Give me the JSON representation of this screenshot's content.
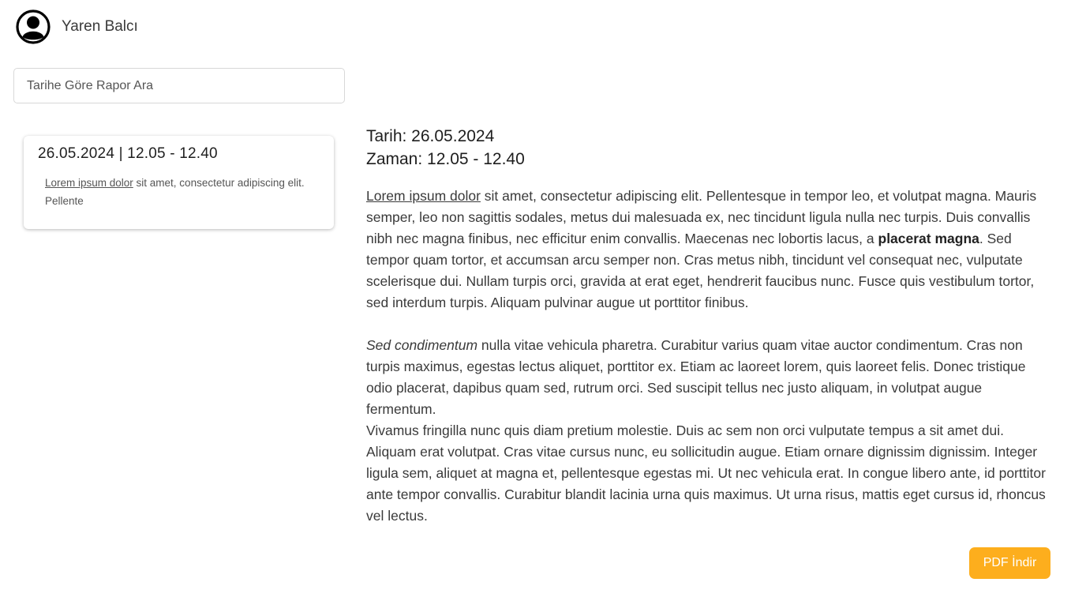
{
  "user": {
    "name": "Yaren Balcı"
  },
  "search": {
    "placeholder": "Tarihe Göre Rapor Ara"
  },
  "reports": [
    {
      "title": "26.05.2024 | 12.05 - 12.40",
      "snippet_underlined": "Lorem ipsum dolor",
      "snippet_rest": " sit amet, consectetur adipiscing elit. Pellente"
    }
  ],
  "detail": {
    "date": "Tarih: 26.05.2024",
    "time": "Zaman: 12.05 - 12.40",
    "p1_underlined": "Lorem ipsum dolor",
    "p1_part1": " sit amet, consectetur adipiscing elit. Pellentesque in tempor leo, et volutpat magna. Mauris semper, leo non sagittis sodales, metus dui malesuada ex, nec tincidunt ligula nulla nec turpis. Duis convallis nibh nec magna finibus, nec efficitur enim convallis. Maecenas nec lobortis lacus, a ",
    "p1_bold": "placerat magna",
    "p1_part2": ". Sed tempor quam tortor, et accumsan arcu semper non. Cras metus nibh, tincidunt vel consequat nec, vulputate scelerisque dui. Nullam turpis orci, gravida at erat eget, hendrerit faucibus nunc. Fusce quis vestibulum tortor, sed interdum turpis. Aliquam pulvinar augue ut porttitor finibus.",
    "p2_italic": "Sed condimentum",
    "p2_rest": " nulla vitae vehicula pharetra. Curabitur varius quam vitae auctor condimentum. Cras non turpis maximus, egestas lectus aliquet, porttitor ex. Etiam ac laoreet lorem, quis laoreet felis. Donec tristique odio placerat, dapibus quam sed, rutrum orci. Sed suscipit tellus nec justo aliquam, in volutpat augue fermentum.",
    "p3": "Vivamus fringilla nunc quis diam pretium molestie. Duis ac sem non orci vulputate tempus a sit amet dui. Aliquam erat volutpat. Cras vitae cursus nunc, eu sollicitudin augue. Etiam ornare dignissim dignissim. Integer ligula sem, aliquet at magna et, pellentesque egestas mi. Ut nec vehicula erat. In congue libero ante, id porttitor ante tempor convallis. Curabitur blandit lacinia urna quis maximus. Ut urna risus, mattis eget cursus id, rhoncus vel lectus."
  },
  "actions": {
    "pdf_label": "PDF İndir"
  },
  "colors": {
    "accent": "#fdae1d",
    "text": "#2b2b2b"
  },
  "icons": {
    "avatar": "user-circle-icon"
  }
}
